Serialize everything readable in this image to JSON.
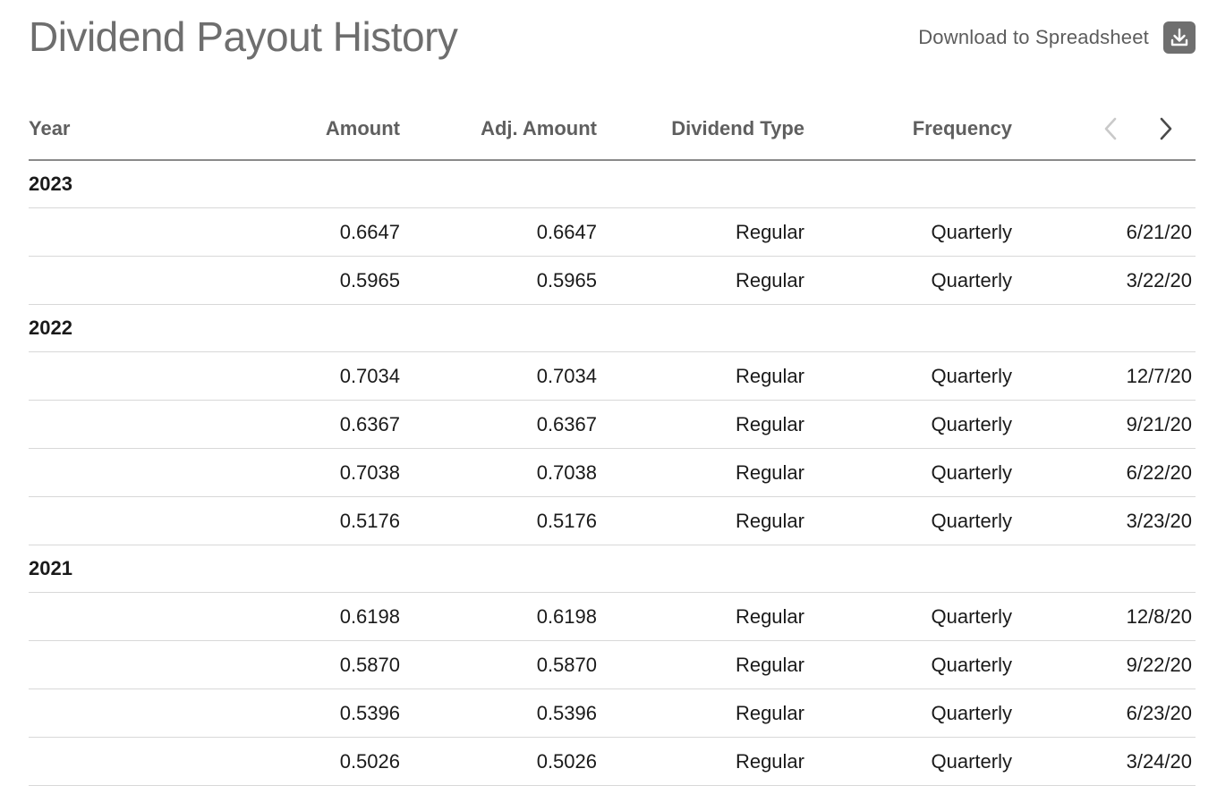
{
  "header": {
    "title": "Dividend Payout History",
    "download_label": "Download to Spreadsheet",
    "download_icon": "download-icon"
  },
  "table": {
    "columns": [
      "Year",
      "Amount",
      "Adj. Amount",
      "Dividend Type",
      "Frequency"
    ],
    "nav": {
      "prev_icon": "chevron-left-icon",
      "next_icon": "chevron-right-icon"
    },
    "groups": [
      {
        "year": "2023",
        "rows": [
          {
            "amount": "0.6647",
            "adj_amount": "0.6647",
            "type": "Regular",
            "frequency": "Quarterly",
            "date": "6/21/20"
          },
          {
            "amount": "0.5965",
            "adj_amount": "0.5965",
            "type": "Regular",
            "frequency": "Quarterly",
            "date": "3/22/20"
          }
        ]
      },
      {
        "year": "2022",
        "rows": [
          {
            "amount": "0.7034",
            "adj_amount": "0.7034",
            "type": "Regular",
            "frequency": "Quarterly",
            "date": "12/7/20"
          },
          {
            "amount": "0.6367",
            "adj_amount": "0.6367",
            "type": "Regular",
            "frequency": "Quarterly",
            "date": "9/21/20"
          },
          {
            "amount": "0.7038",
            "adj_amount": "0.7038",
            "type": "Regular",
            "frequency": "Quarterly",
            "date": "6/22/20"
          },
          {
            "amount": "0.5176",
            "adj_amount": "0.5176",
            "type": "Regular",
            "frequency": "Quarterly",
            "date": "3/23/20"
          }
        ]
      },
      {
        "year": "2021",
        "rows": [
          {
            "amount": "0.6198",
            "adj_amount": "0.6198",
            "type": "Regular",
            "frequency": "Quarterly",
            "date": "12/8/20"
          },
          {
            "amount": "0.5870",
            "adj_amount": "0.5870",
            "type": "Regular",
            "frequency": "Quarterly",
            "date": "9/22/20"
          },
          {
            "amount": "0.5396",
            "adj_amount": "0.5396",
            "type": "Regular",
            "frequency": "Quarterly",
            "date": "6/23/20"
          },
          {
            "amount": "0.5026",
            "adj_amount": "0.5026",
            "type": "Regular",
            "frequency": "Quarterly",
            "date": "3/24/20"
          }
        ]
      }
    ]
  }
}
